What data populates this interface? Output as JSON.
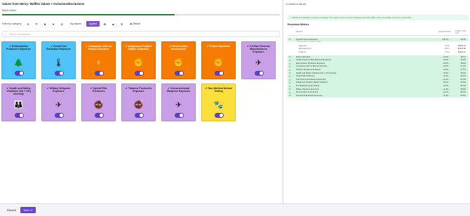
{
  "page": {
    "title": "Values from Henry: Waffles Values + Inclusions/Exclusions",
    "metric_label": "Metric Meter",
    "progress": 0.62
  },
  "filters": {
    "label": "Filter by category",
    "icons": [
      "❄",
      "☂",
      "♞",
      "♥",
      "☮"
    ],
    "top_issues": "Top Issues",
    "applied": "Applied",
    "more_icons": [
      "✿",
      "☯",
      "☰"
    ],
    "difficult": "Difficult"
  },
  "search": {
    "placeholder": "Search by keyword"
  },
  "cards": [
    {
      "name": "Deforestation Producers Exposure",
      "color": "blue",
      "icon": "tree-icon",
      "glyph": "🌲"
    },
    {
      "name": "Fossil Fuel Extraction Exposure",
      "color": "blue",
      "icon": "thermometer-icon",
      "glyph": "🌡"
    },
    {
      "name": "Companies with no Women Directors",
      "color": "orange",
      "icon": "woman-icon",
      "glyph": "♀"
    },
    {
      "name": "Indigenous Peoples' Rights Violations",
      "color": "orange",
      "icon": "raised-fist-icon",
      "glyph": "✊"
    },
    {
      "name": "Forced Labor Involvement",
      "color": "orange",
      "icon": "raised-fist-icon",
      "glyph": "✊"
    },
    {
      "name": "Prison Operators",
      "color": "orange",
      "icon": "raised-fist-icon",
      "glyph": "✊"
    },
    {
      "name": "Civilian Firearms Manufacturers Exposure",
      "color": "purple",
      "icon": "airplane-icon",
      "glyph": "✈"
    },
    {
      "name": "Health and Safety Violations (US + UK) Intensity",
      "color": "purple",
      "icon": "people-icon",
      "glyph": "👪"
    },
    {
      "name": "Military Weapons Exposure",
      "color": "purple",
      "icon": "airplane-icon",
      "glyph": "✈"
    },
    {
      "name": "Opioid Pills Producers",
      "color": "purple",
      "icon": "no-smoking-icon",
      "glyph": "🚭"
    },
    {
      "name": "Tobacco Producers Exposure",
      "color": "purple",
      "icon": "no-smoking-icon",
      "glyph": "🚭"
    },
    {
      "name": "Unconventional Weapons Exposure",
      "color": "purple",
      "icon": "airplane-icon",
      "glyph": "✈"
    },
    {
      "name": "Non-Medical Animal Testing",
      "color": "yellow",
      "icon": "paw-icon",
      "glyph": "🐾"
    }
  ],
  "bottom": {
    "discard": "Discard",
    "save": "Save ➔"
  },
  "right": {
    "header": "12 metrics in this set",
    "alert": "✓ 58.5% of investable universe excluded. The metric meter is green because less than 60% of the investable universe is excluded.",
    "exclusion_title": "Exclusion Metrics",
    "columns": {
      "metric": "METRIC",
      "exceptional": "EXCEPTIONAL",
      "conn": "CUMUL. NET CAP"
    },
    "rows": [
      {
        "name": "Specific Ticker Exclusions",
        "v1": "+18.4% ↓",
        "v2": "18.4%",
        "hl": true,
        "kind": "main"
      },
      {
        "name": "Click a ticker to exclude / 3 tickers",
        "v1": "",
        "v2": "",
        "kind": "note"
      },
      {
        "name": "Apple Inc.",
        "v1": "AAPL",
        "v2": "$3402.15",
        "kind": "sub"
      },
      {
        "name": "Microsoft Corp",
        "v1": "MSFT",
        "v2": "$3121.00",
        "kind": "sub"
      },
      {
        "name": "Tesla Inc.",
        "v1": "TSLA",
        "v2": "$1024.10",
        "kind": "sub"
      },
      {
        "name": "Prison Operators",
        "v1": "+0.2% ↓",
        "v2": "18.1%",
        "hl": true,
        "kind": "main",
        "gap": true
      },
      {
        "name": "Civilian Firearms Manufacturers Exposure",
        "v1": "+0.3% ↓",
        "v2": "18.3%",
        "hl": true,
        "kind": "main"
      },
      {
        "name": "Deforestation Producers Exposure",
        "v1": "+0.5% ↓",
        "v2": "18.6%",
        "hl": true,
        "kind": "main"
      },
      {
        "name": "Companies with no Women Directors",
        "v1": "+0.4% ↓",
        "v2": "17.2%",
        "hl": true,
        "kind": "main"
      },
      {
        "name": "Tobacco Producers Exposure",
        "v1": "+0.6% ↓",
        "v2": "17.7%",
        "hl": true,
        "kind": "main"
      },
      {
        "name": "Health and Safety Violations (US + UK) Intensity",
        "v1": "+0.5% ↓",
        "v2": "18.4%",
        "hl": true,
        "kind": "main"
      },
      {
        "name": "Opioid Pills Producers",
        "v1": "+1.6% ↓",
        "v2": "20.2%",
        "hl": true,
        "kind": "main"
      },
      {
        "name": "Unconventional Weapons Exposure",
        "v1": "+2.3% ↓",
        "v2": "22.4%",
        "hl": true,
        "kind": "main"
      },
      {
        "name": "Indigenous Peoples' Rights Violations",
        "v1": "+2.1% ↓",
        "v2": "24.6%",
        "hl": true,
        "kind": "main"
      },
      {
        "name": "Non-Medical Animal Testing",
        "v1": "+3.3% ↓",
        "v2": "26.7%",
        "hl": true,
        "kind": "main"
      },
      {
        "name": "Military Weapons Exposure",
        "v1": "+1.4% ↓",
        "v2": "28.0%",
        "hl": true,
        "kind": "main"
      },
      {
        "name": "Forced Labor Involvement",
        "v1": "+2.1% ↓",
        "v2": "30.0%",
        "hl": true,
        "kind": "main"
      },
      {
        "name": "Fossil Fuel Extraction Exposure",
        "v1": "+4.4% ↓",
        "v2": "34.5%",
        "hl": true,
        "kind": "main"
      }
    ]
  }
}
